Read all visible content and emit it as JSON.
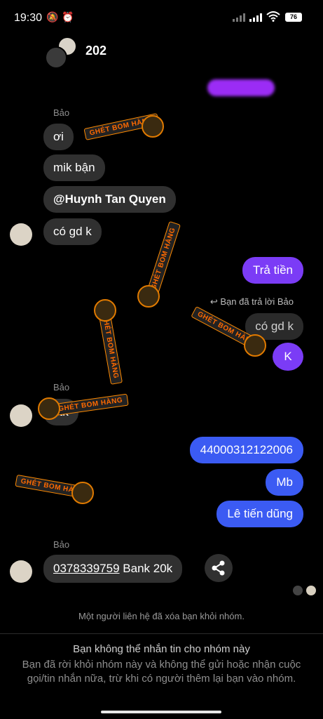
{
  "status": {
    "time": "19:30",
    "battery": "76"
  },
  "header": {
    "title": "202"
  },
  "messages": {
    "sender1": "Bảo",
    "in1": [
      "ơi",
      "mik bận",
      "@Huynh Tan Quyen",
      "có gd k"
    ],
    "out1": "Trả tiền",
    "reply_note": "Bạn đã trả lời Bảo",
    "reply_quote": "có gd k",
    "out2": "K",
    "sender2": "Bảo",
    "in2": "stk",
    "out3": [
      "44000312122006",
      "Mb",
      "Lê tiến dũng"
    ],
    "sender3": "Bảo",
    "in3_link": "0378339759",
    "in3_rest": " Bank 20k"
  },
  "system_note": "Một người liên hệ đã xóa bạn khỏi nhóm.",
  "footer": {
    "title": "Bạn không thể nhắn tin cho nhóm này",
    "desc": "Bạn đã rời khỏi nhóm này và không thể gửi hoặc nhận cuộc gọi/tin nhắn nữa, trừ khi có người thêm lại bạn vào nhóm."
  },
  "watermark": "GHÉT BOM HÀNG",
  "colors": {
    "purple": "#7b3cf6",
    "blue": "#3b5bf3",
    "bubble_in": "#303030"
  }
}
